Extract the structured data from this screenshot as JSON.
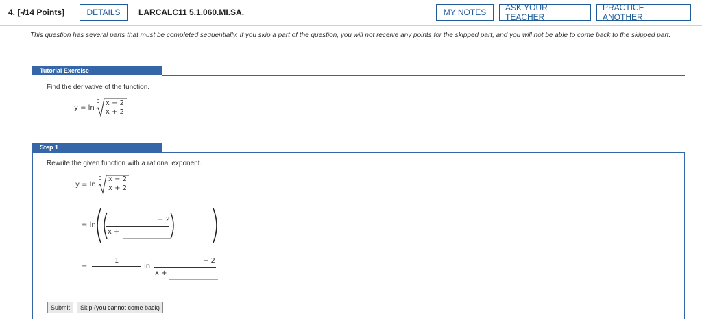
{
  "header": {
    "question_number": "4. [-/14 Points]",
    "details_label": "DETAILS",
    "code": "LARCALC11 5.1.060.MI.SA.",
    "my_notes_label": "MY NOTES",
    "ask_teacher_label": "ASK YOUR TEACHER",
    "practice_label": "PRACTICE ANOTHER"
  },
  "intro": "This question has several parts that must be completed sequentially. If you skip a part of the question, you will not receive any points for the skipped part, and you will not be able to come back to the skipped part.",
  "tutorial": {
    "header": "Tutorial Exercise",
    "prompt": "Find the derivative of the function.",
    "eq_lhs": "y = ln",
    "root_index": "3",
    "numerator": "x − 2",
    "denominator": "x + 2"
  },
  "step1": {
    "header": "Step 1",
    "prompt": "Rewrite the given function with a rational exponent.",
    "eq_lhs": "y = ln",
    "root_index": "3",
    "numerator": "x − 2",
    "denominator": "x + 2",
    "line2_prefix": "= ln",
    "line2_numer_suffix": "− 2",
    "line2_denom_prefix": "x +",
    "line3_prefix": "=",
    "line3_coef_numer": "1",
    "line3_ln": "ln",
    "line3_numer_suffix": "− 2",
    "line3_denom_prefix": "x +"
  },
  "buttons": {
    "submit": "Submit",
    "skip": "Skip (you cannot come back)"
  },
  "colors": {
    "accent": "#1f5c99",
    "tab_blue": "#3466a8",
    "emphasis_red": "#c0392b"
  }
}
